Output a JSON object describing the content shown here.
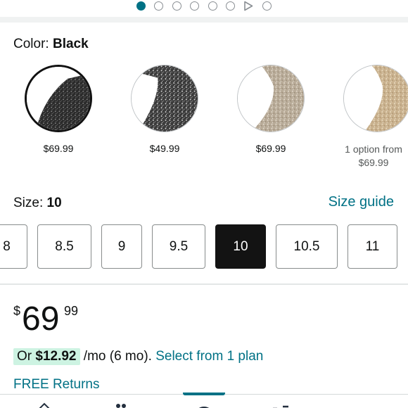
{
  "carousel": {
    "dot_count": 7,
    "active_index": 0,
    "has_video": true
  },
  "color": {
    "label": "Color:",
    "selected": "Black",
    "options": [
      {
        "price": "$69.99",
        "selected": true,
        "tone": "black"
      },
      {
        "price": "$49.99",
        "selected": false,
        "tone": "black-silver"
      },
      {
        "price": "$69.99",
        "selected": false,
        "tone": "champagne"
      },
      {
        "price_line1": "1 option from",
        "price_line2": "$69.99",
        "selected": false,
        "tone": "gold"
      }
    ]
  },
  "size": {
    "label": "Size:",
    "selected": "10",
    "guide_label": "Size guide",
    "options": [
      "8",
      "8.5",
      "9",
      "9.5",
      "10",
      "10.5",
      "11"
    ]
  },
  "price": {
    "symbol": "$",
    "whole": "69",
    "fraction": "99"
  },
  "financing": {
    "prefix": "Or ",
    "amount": "$12.92",
    "term": " /mo (6 mo). ",
    "link": "Select from 1 plan"
  },
  "returns": {
    "label": "FREE Returns"
  },
  "colors": {
    "link": "#007185",
    "selected_size_bg": "#131313",
    "financing_highlight": "#cdf3e2",
    "active_dot": "#007185"
  }
}
